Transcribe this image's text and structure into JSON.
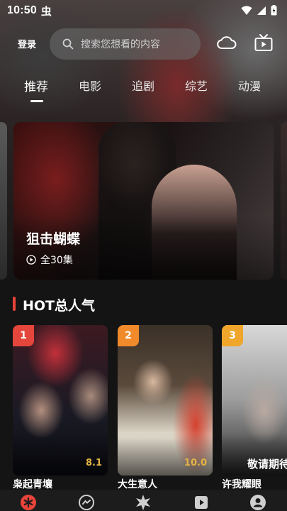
{
  "status_bar": {
    "time": "10:50",
    "app_glyph": "虫"
  },
  "header": {
    "login_label": "登录",
    "search": {
      "placeholder": "搜索您想看的内容"
    },
    "icons": [
      "cloud-icon",
      "tv-icon"
    ]
  },
  "tabs": [
    {
      "label": "推荐",
      "active": true
    },
    {
      "label": "电影"
    },
    {
      "label": "追剧"
    },
    {
      "label": "综艺"
    },
    {
      "label": "动漫"
    }
  ],
  "banner": {
    "title": "狙击蝴蝶",
    "episodes": "全30集"
  },
  "section": {
    "title": "HOT总人气"
  },
  "cards": [
    {
      "rank": "1",
      "title": "枭起青壤",
      "score": "8.1"
    },
    {
      "rank": "2",
      "title": "大生意人",
      "score": "10.0"
    },
    {
      "rank": "3",
      "title": "许我耀眼",
      "poster_text": "敬请期待"
    }
  ],
  "colors": {
    "accent": "#e8443a",
    "score": "#e3b544",
    "rank1": "#e5463c",
    "rank2": "#f08a2a",
    "rank3": "#f0a62a"
  }
}
